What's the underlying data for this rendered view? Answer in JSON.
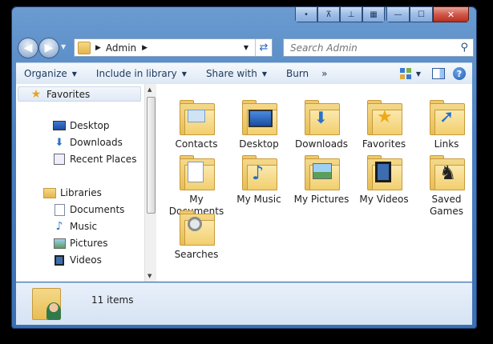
{
  "window": {
    "caption_buttons": [
      "•",
      "⊼",
      "⊥",
      "▦"
    ],
    "minimize": "—",
    "maximize": "☐",
    "close": "✕"
  },
  "address": {
    "path": [
      "Admin"
    ],
    "refresh_icon": "refresh-icon"
  },
  "search": {
    "placeholder": "Search Admin"
  },
  "toolbar": {
    "organize": "Organize",
    "include_in_library": "Include in library",
    "share_with": "Share with",
    "burn": "Burn",
    "more": "»"
  },
  "nav": {
    "favorites": {
      "label": "Favorites",
      "items": [
        "Desktop",
        "Downloads",
        "Recent Places"
      ]
    },
    "libraries": {
      "label": "Libraries",
      "items": [
        "Documents",
        "Music",
        "Pictures",
        "Videos"
      ]
    }
  },
  "items": [
    {
      "label": "Contacts",
      "icon": "contacts-icon"
    },
    {
      "label": "Desktop",
      "icon": "desktop-icon"
    },
    {
      "label": "Downloads",
      "icon": "downloads-icon"
    },
    {
      "label": "Favorites",
      "icon": "favorites-icon"
    },
    {
      "label": "Links",
      "icon": "links-icon"
    },
    {
      "label": "My Documents",
      "icon": "documents-icon"
    },
    {
      "label": "My Music",
      "icon": "music-icon"
    },
    {
      "label": "My Pictures",
      "icon": "pictures-icon"
    },
    {
      "label": "My Videos",
      "icon": "videos-icon"
    },
    {
      "label": "Saved Games",
      "icon": "games-icon"
    },
    {
      "label": "Searches",
      "icon": "searches-icon"
    }
  ],
  "status": {
    "count": "11 items"
  },
  "colors": {
    "frame": "#4a7fc0",
    "close": "#c7412f",
    "folder": "#f2cf6e"
  }
}
